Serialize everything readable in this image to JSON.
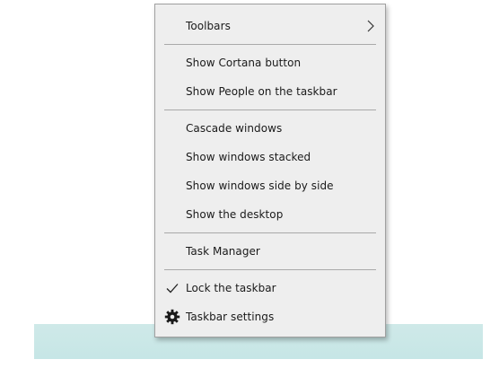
{
  "menu": {
    "toolbars": "Toolbars",
    "show_cortana": "Show Cortana button",
    "show_people": "Show People on the taskbar",
    "cascade": "Cascade windows",
    "stacked": "Show windows stacked",
    "side_by_side": "Show windows side by side",
    "show_desktop": "Show the desktop",
    "task_manager": "Task Manager",
    "lock_taskbar": "Lock the taskbar",
    "taskbar_settings": "Taskbar settings"
  },
  "state": {
    "lock_taskbar_checked": true
  },
  "colors": {
    "menu_bg": "#eeeeee",
    "menu_border": "#a0a0a0",
    "separator": "#a9a9a9",
    "text": "#1a1a1a",
    "taskbar": "#c9e7e7"
  },
  "icons": {
    "toolbars_submenu": "chevron-right-icon",
    "lock_taskbar": "checkmark-icon",
    "taskbar_settings": "gear-icon"
  }
}
